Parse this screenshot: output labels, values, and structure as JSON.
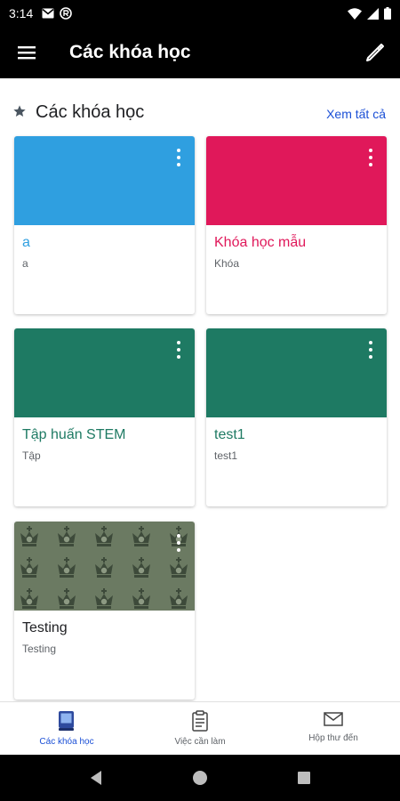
{
  "status_bar": {
    "time": "3:14"
  },
  "app_bar": {
    "title": "Các khóa học"
  },
  "section": {
    "title": "Các khóa học",
    "see_all": "Xem tất cả"
  },
  "colors": {
    "accent": "#1a4fd6",
    "blue": "#2f9fe0",
    "pink": "#e0185a",
    "green": "#1e7a63",
    "olive": "#6b7a62"
  },
  "courses": [
    {
      "title": "a",
      "subtitle": "a",
      "color": "#2f9fe0",
      "title_color": "#2f9fe0"
    },
    {
      "title": "Khóa học mẫu",
      "subtitle": "Khóa",
      "color": "#e0185a",
      "title_color": "#e0185a"
    },
    {
      "title": "Tập huấn STEM",
      "subtitle": "Tập",
      "color": "#1e7a63",
      "title_color": "#1e7a63"
    },
    {
      "title": "test1",
      "subtitle": "test1",
      "color": "#1e7a63",
      "title_color": "#1e7a63"
    },
    {
      "title": "Testing",
      "subtitle": "Testing",
      "color": "#6b7a62",
      "title_color": "#202124"
    }
  ],
  "bottom_nav": [
    {
      "label": "Các khóa học",
      "icon": "courses-icon",
      "active": true
    },
    {
      "label": "Việc cần làm",
      "icon": "clipboard-icon",
      "active": false
    },
    {
      "label": "Hộp thư đến",
      "icon": "mail-icon",
      "active": false
    }
  ]
}
